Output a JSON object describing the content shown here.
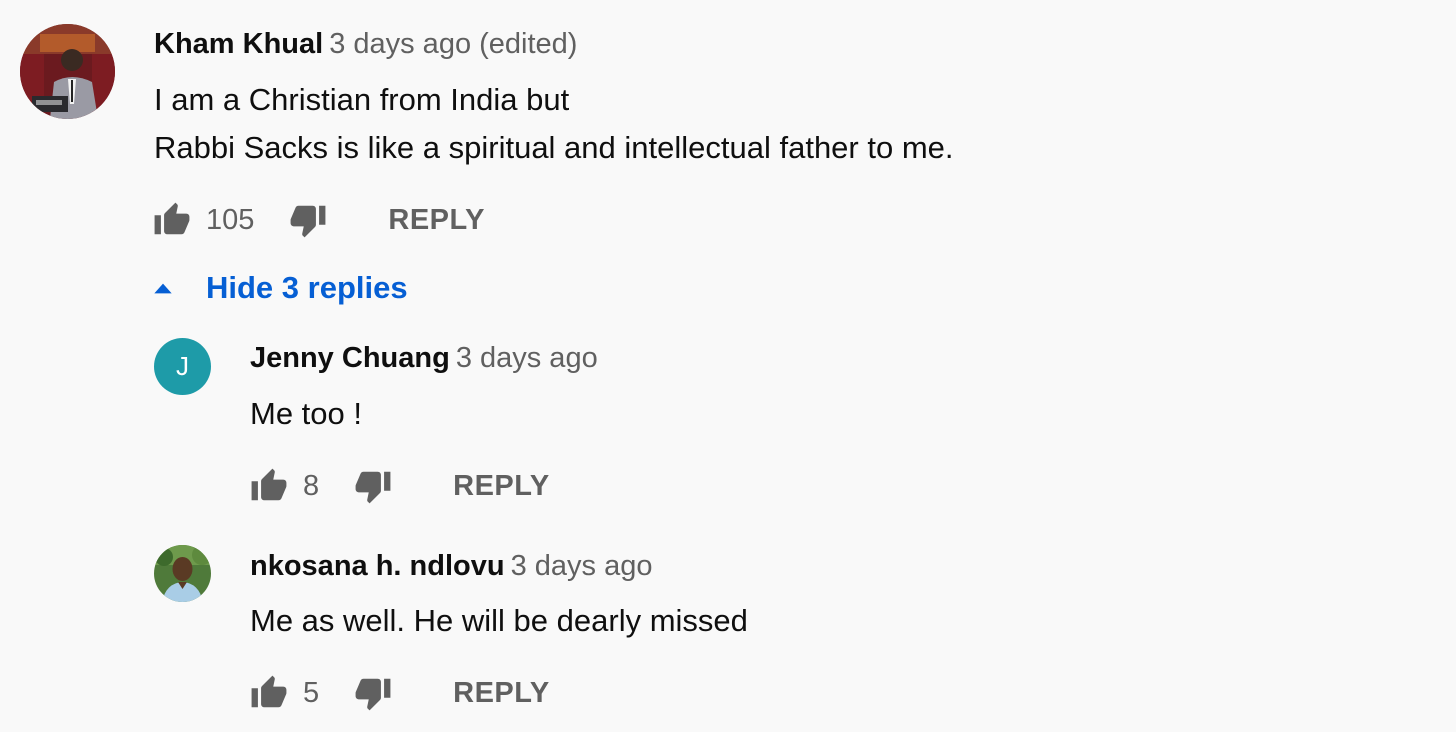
{
  "comment": {
    "author": "Kham Khual",
    "time": "3 days ago (edited)",
    "text_lines": [
      "I am a Christian from India but",
      "Rabbi Sacks is like a spiritual and intellectual father to me."
    ],
    "like_count": "105",
    "reply_label": "REPLY"
  },
  "replies_toggle": {
    "label": "Hide 3 replies",
    "icon": "caret-up-icon"
  },
  "replies": [
    {
      "author": "Jenny Chuang",
      "time": "3 days ago",
      "avatar_letter": "J",
      "avatar_color": "#1e9ba8",
      "text": "Me too !",
      "like_count": "8",
      "reply_label": "REPLY"
    },
    {
      "author": "nkosana h. ndlovu",
      "time": "3 days ago",
      "text": "Me as well. He will be dearly missed",
      "like_count": "5",
      "reply_label": "REPLY"
    }
  ],
  "colors": {
    "background": "#f9f9f9",
    "primary_text": "#0f0f0f",
    "secondary_text": "#606060",
    "link_blue": "#065fd4"
  }
}
